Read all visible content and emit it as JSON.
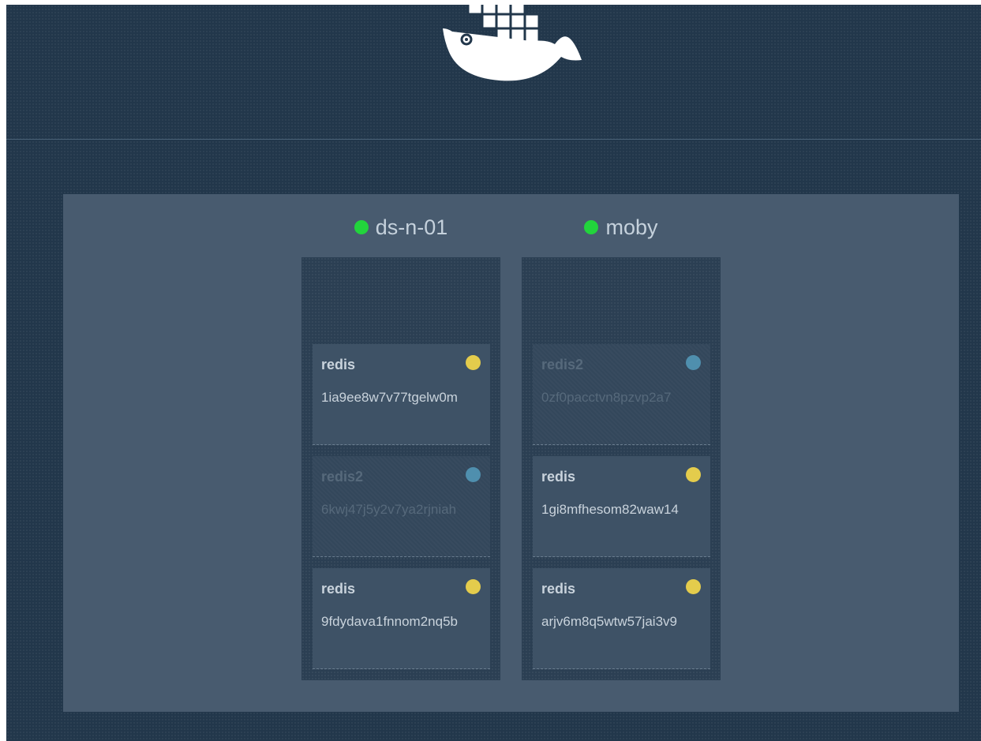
{
  "colors": {
    "running": "#e4cc4c",
    "pending": "#4f8fae",
    "node_ready": "#22d43c"
  },
  "header": {
    "logo_icon": "docker-whale-logo"
  },
  "nodes": [
    {
      "name": "ds-n-01",
      "status_color": "#22d43c",
      "tasks": [
        {
          "service": "redis",
          "id": "1ia9ee8w7v77tgelw0m",
          "state": "running",
          "dot_color": "#e4cc4c"
        },
        {
          "service": "redis2",
          "id": "6kwj47j5y2v7ya2rjniah",
          "state": "pending",
          "dot_color": "#4f8fae"
        },
        {
          "service": "redis",
          "id": "9fdydava1fnnom2nq5b",
          "state": "running",
          "dot_color": "#e4cc4c"
        }
      ]
    },
    {
      "name": "moby",
      "status_color": "#22d43c",
      "tasks": [
        {
          "service": "redis2",
          "id": "0zf0pacctvn8pzvp2a7",
          "state": "pending",
          "dot_color": "#4f8fae"
        },
        {
          "service": "redis",
          "id": "1gi8mfhesom82waw14",
          "state": "running",
          "dot_color": "#e4cc4c"
        },
        {
          "service": "redis",
          "id": "arjv6m8q5wtw57jai3v9",
          "state": "running",
          "dot_color": "#e4cc4c"
        }
      ]
    }
  ]
}
